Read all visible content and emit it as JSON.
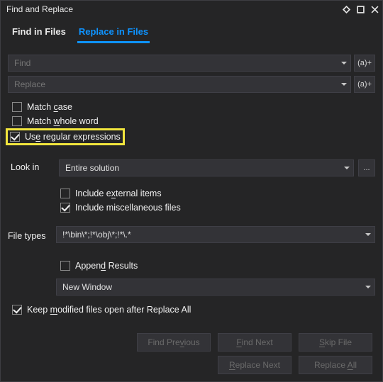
{
  "window": {
    "title": "Find and Replace"
  },
  "tabs": {
    "find": "Find in Files",
    "replace": "Replace in Files"
  },
  "fields": {
    "find_placeholder": "Find",
    "replace_placeholder": "Replace",
    "regex_hint": "(a)+"
  },
  "options": {
    "match_case": "Match case",
    "match_whole": "Match whole word",
    "use_regex": "Use regular expressions"
  },
  "lookin": {
    "label": "Look in",
    "value": "Entire solution",
    "browse": "...",
    "include_external": "Include external items",
    "include_misc": "Include miscellaneous files"
  },
  "filetypes": {
    "label": "File types",
    "value": "!*\\bin\\*;!*\\obj\\*;!*\\.*"
  },
  "results": {
    "append": "Append Results",
    "target": "New Window"
  },
  "keep_open": "Keep modified files open after Replace All",
  "buttons": {
    "find_prev": "Find Previous",
    "find_next": "Find Next",
    "skip_file": "Skip File",
    "replace_next": "Replace Next",
    "replace_all": "Replace All"
  }
}
